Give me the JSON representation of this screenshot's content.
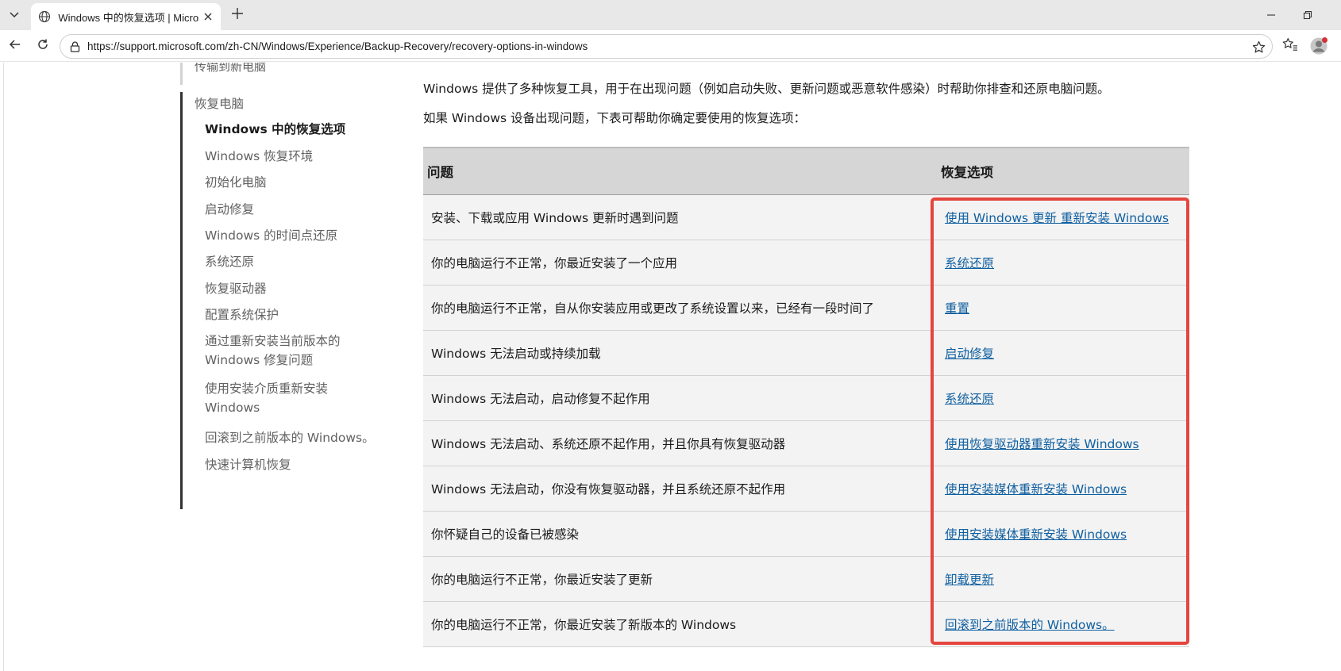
{
  "browser": {
    "tab_title": "Windows 中的恢复选项 | Microsoft",
    "url": "https://support.microsoft.com/zh-CN/Windows/Experience/Backup-Recovery/recovery-options-in-windows",
    "icons": {
      "tab_menu": "chevron-down-icon",
      "favicon": "globe-icon",
      "tab_close": "close-icon",
      "new_tab": "plus-icon",
      "minimize": "minimize-icon",
      "restore": "restore-icon",
      "back": "back-arrow-icon",
      "refresh": "refresh-icon",
      "lock": "lock-icon",
      "favorite": "star-icon",
      "favorites_list": "favorites-icon",
      "profile": "profile-icon"
    },
    "colors": {
      "profile_dot": "#d13438"
    }
  },
  "sidenav": {
    "prev_item": "传输到新电脑",
    "section": "恢复电脑",
    "items": [
      {
        "label": "Windows 中的恢复选项",
        "current": true
      },
      {
        "label": "Windows 恢复环境"
      },
      {
        "label": "初始化电脑"
      },
      {
        "label": "启动修复"
      },
      {
        "label": "Windows 的时间点还原"
      },
      {
        "label": "系统还原"
      },
      {
        "label": "恢复驱动器"
      },
      {
        "label": "配置系统保护"
      },
      {
        "label": "通过重新安装当前版本的",
        "label2": "Windows 修复问题"
      },
      {
        "label": "使用安装介质重新安装",
        "label2": "Windows"
      },
      {
        "label": "回滚到之前版本的 Windows。"
      },
      {
        "label": "快速计算机恢复"
      }
    ]
  },
  "content": {
    "intro1": "Windows 提供了多种恢复工具，用于在出现问题（例如启动失败、更新问题或恶意软件感染）时帮助你排查和还原电脑问题。",
    "intro2": "如果 Windows 设备出现问题，下表可帮助你确定要使用的恢复选项：",
    "table": {
      "headers": [
        "问题",
        "恢复选项"
      ],
      "rows": [
        {
          "problem": "安装、下载或应用 Windows 更新时遇到问题",
          "option": "使用 Windows 更新 重新安装 Windows"
        },
        {
          "problem": "你的电脑运行不正常，你最近安装了一个应用",
          "option": "系统还原"
        },
        {
          "problem": "你的电脑运行不正常，自从你安装应用或更改了系统设置以来，已经有一段时间了",
          "option": "重置"
        },
        {
          "problem": "Windows 无法启动或持续加载",
          "option": "启动修复"
        },
        {
          "problem": "Windows 无法启动，启动修复不起作用",
          "option": "系统还原"
        },
        {
          "problem": "Windows 无法启动、系统还原不起作用，并且你具有恢复驱动器",
          "option": "使用恢复驱动器重新安装 Windows"
        },
        {
          "problem": "Windows 无法启动，你没有恢复驱动器，并且系统还原不起作用",
          "option": "使用安装媒体重新安装 Windows"
        },
        {
          "problem": "你怀疑自己的设备已被感染",
          "option": "使用安装媒体重新安装 Windows"
        },
        {
          "problem": "你的电脑运行不正常，你最近安装了更新",
          "option": "卸载更新"
        },
        {
          "problem": "你的电脑运行不正常，你最近安装了新版本的 Windows",
          "option": "回滚到之前版本的 Windows。"
        }
      ]
    },
    "colors": {
      "link": "#0f5fa0",
      "highlight": "#e5453d",
      "table_header_bg": "#d6d6d6",
      "row_bg": "#f3f3f3"
    }
  }
}
